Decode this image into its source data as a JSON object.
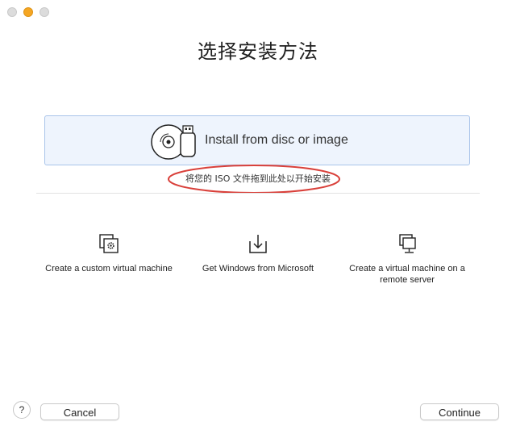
{
  "window": {
    "title": "选择安装方法",
    "controls": [
      "close-icon",
      "minimize-icon",
      "zoom-icon"
    ]
  },
  "install": {
    "label": "Install from disc or image",
    "icon": "disc-and-usb-icon",
    "hint": "将您的 ISO 文件拖到此处以开始安装"
  },
  "options": [
    {
      "label": "Create a custom virtual machine",
      "icon": "custom-vm-gear-icon"
    },
    {
      "label": "Get Windows from Microsoft",
      "icon": "download-icon"
    },
    {
      "label": "Create a virtual machine on a remote server",
      "icon": "remote-server-icon"
    }
  ],
  "footer": {
    "help": "?",
    "cancel": "Cancel",
    "continue": "Continue"
  },
  "colors": {
    "install_bg": "#eef4fd",
    "install_border": "#a9c4ea",
    "annotation": "#d9403a",
    "traffic_active": "#f5a623"
  }
}
